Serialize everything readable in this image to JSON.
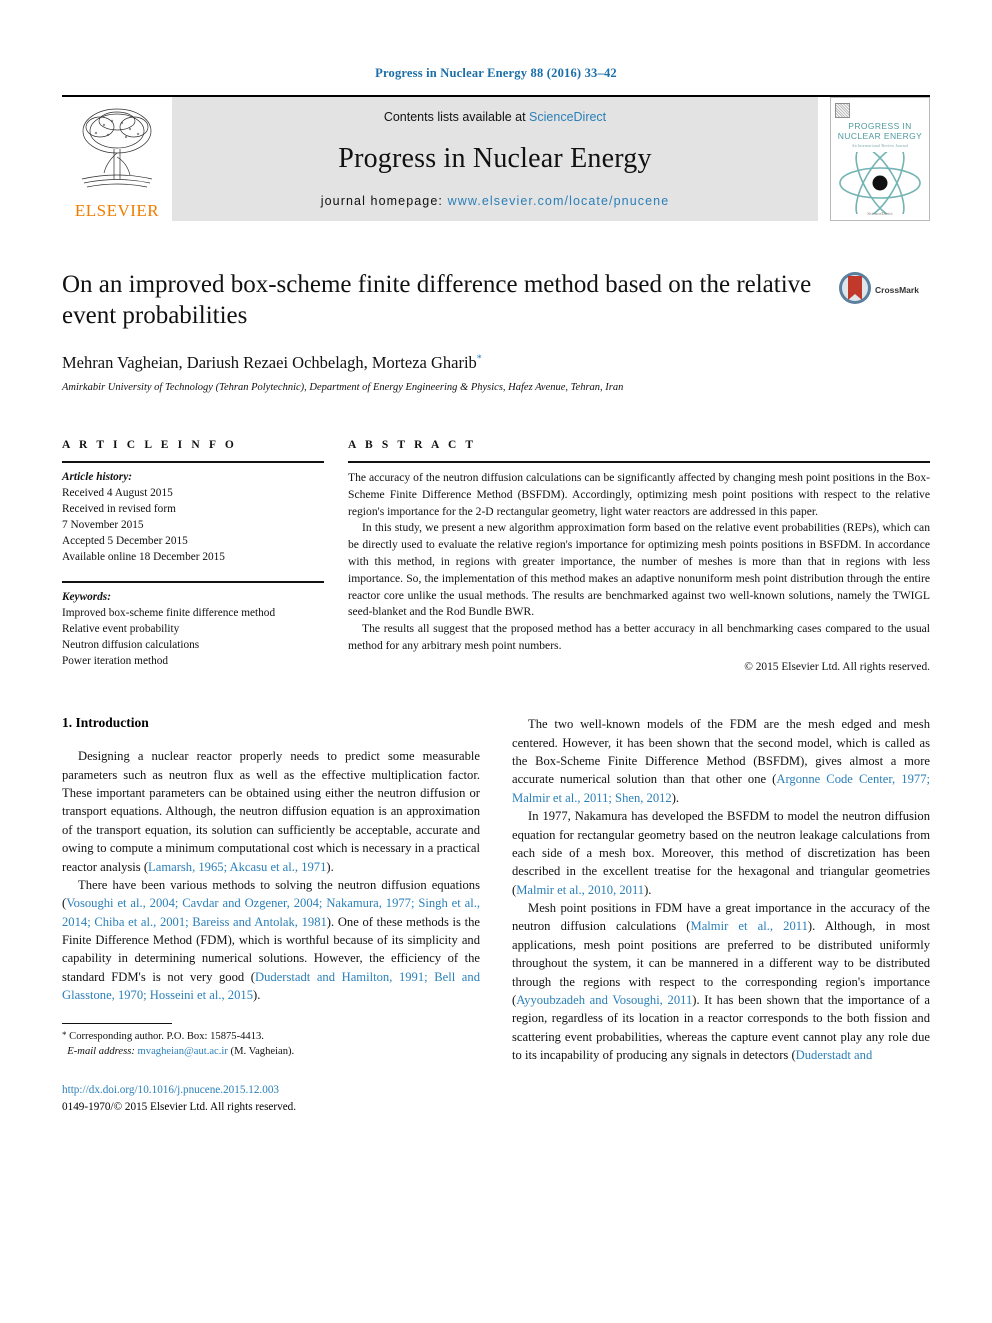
{
  "running_head": "Progress in Nuclear Energy 88 (2016) 33–42",
  "masthead": {
    "publisher_name": "ELSEVIER",
    "contents_prefix": "Contents lists available at ",
    "contents_link": "ScienceDirect",
    "journal_title": "Progress in Nuclear Energy",
    "homepage_prefix": "journal homepage: ",
    "homepage_url": "www.elsevier.com/locate/pnucene",
    "cover": {
      "title_line1": "PROGRESS IN",
      "title_line2": "NUCLEAR ENERGY",
      "subtitle": "An International Review Journal",
      "footer": "ScienceDirect"
    }
  },
  "article": {
    "title": "On an improved box-scheme finite difference method based on the relative event probabilities",
    "authors": "Mehran Vagheian, Dariush Rezaei Ochbelagh, Morteza Gharib",
    "author_marker": "*",
    "affiliation": "Amirkabir University of Technology (Tehran Polytechnic), Department of Energy Engineering & Physics, Hafez Avenue, Tehran, Iran",
    "crossmark_label": "CrossMark"
  },
  "article_info": {
    "heading": "A R T I C L E   I N F O",
    "history_label": "Article history:",
    "history": [
      "Received 4 August 2015",
      "Received in revised form",
      "7 November 2015",
      "Accepted 5 December 2015",
      "Available online 18 December 2015"
    ],
    "keywords_label": "Keywords:",
    "keywords": [
      "Improved box-scheme finite difference method",
      "Relative event probability",
      "Neutron diffusion calculations",
      "Power iteration method"
    ]
  },
  "abstract": {
    "heading": "A B S T R A C T",
    "paragraphs": [
      "The accuracy of the neutron diffusion calculations can be significantly affected by changing mesh point positions in the Box-Scheme Finite Difference Method (BSFDM). Accordingly, optimizing mesh point positions with respect to the relative region's importance for the 2-D rectangular geometry, light water reactors are addressed in this paper.",
      "In this study, we present a new algorithm approximation form based on the relative event probabilities (REPs), which can be directly used to evaluate the relative region's importance for optimizing mesh points positions in BSFDM. In accordance with this method, in regions with greater importance, the number of meshes is more than that in regions with less importance. So, the implementation of this method makes an adaptive nonuniform mesh point distribution through the entire reactor core unlike the usual methods. The results are benchmarked against two well-known solutions, namely the TWIGL seed-blanket and the Rod Bundle BWR.",
      "The results all suggest that the proposed method has a better accuracy in all benchmarking cases compared to the usual method for any arbitrary mesh point numbers."
    ],
    "copyright": "© 2015 Elsevier Ltd. All rights reserved."
  },
  "body": {
    "section_heading": "1. Introduction",
    "left_paragraphs": [
      {
        "runs": [
          {
            "t": "Designing a nuclear reactor properly needs to predict some measurable parameters such as neutron flux as well as the effective multiplication factor. These important parameters can be obtained using either the neutron diffusion or transport equations. Although, the neutron diffusion equation is an approximation of the transport equation, its solution can sufficiently be acceptable, accurate and owing to compute a minimum computational cost which is necessary in a practical reactor analysis (",
            "r": false
          },
          {
            "t": "Lamarsh, 1965; Akcasu et al., 1971",
            "r": true
          },
          {
            "t": ").",
            "r": false
          }
        ]
      },
      {
        "runs": [
          {
            "t": "There have been various methods to solving the neutron diffusion equations (",
            "r": false
          },
          {
            "t": "Vosoughi et al., 2004; Cavdar and Ozgener, 2004; Nakamura, 1977; Singh et al., 2014; Chiba et al., 2001; Bareiss and Antolak, 1981",
            "r": true
          },
          {
            "t": "). One of these methods is the Finite Difference Method (FDM), which is worthful because of its simplicity and capability in determining numerical solutions. However, the efficiency of the standard FDM's is not very good (",
            "r": false
          },
          {
            "t": "Duderstadt and Hamilton, 1991; Bell and Glasstone, 1970; Hosseini et al., 2015",
            "r": true
          },
          {
            "t": ").",
            "r": false
          }
        ]
      }
    ],
    "right_paragraphs": [
      {
        "runs": [
          {
            "t": "The two well-known models of the FDM are the mesh edged and mesh centered. However, it has been shown that the second model, which is called as the Box-Scheme Finite Difference Method (BSFDM), gives almost a more accurate numerical solution than that other one (",
            "r": false
          },
          {
            "t": "Argonne Code Center, 1977; Malmir et al., 2011; Shen, 2012",
            "r": true
          },
          {
            "t": ").",
            "r": false
          }
        ]
      },
      {
        "runs": [
          {
            "t": "In 1977, Nakamura has developed the BSFDM to model the neutron diffusion equation for rectangular geometry based on the neutron leakage calculations from each side of a mesh box. Moreover, this method of discretization has been described in the excellent treatise for the hexagonal and triangular geometries (",
            "r": false
          },
          {
            "t": "Malmir et al., 2010, 2011",
            "r": true
          },
          {
            "t": ").",
            "r": false
          }
        ]
      },
      {
        "runs": [
          {
            "t": "Mesh point positions in FDM have a great importance in the accuracy of the neutron diffusion calculations (",
            "r": false
          },
          {
            "t": "Malmir et al., 2011",
            "r": true
          },
          {
            "t": "). Although, in most applications, mesh point positions are preferred to be distributed uniformly throughout the system, it can be mannered in a different way to be distributed through the regions with respect to the corresponding region's importance (",
            "r": false
          },
          {
            "t": "Ayyoubzadeh and Vosoughi, 2011",
            "r": true
          },
          {
            "t": "). It has been shown that the importance of a region, regardless of its location in a reactor corresponds to the both fission and scattering event probabilities, whereas the capture event cannot play any role due to its incapability of producing any signals in detectors (",
            "r": false
          },
          {
            "t": "Duderstadt and",
            "r": true
          }
        ]
      }
    ]
  },
  "footer": {
    "corresponding_marker": "*",
    "corresponding_text": "Corresponding author. P.O. Box: 15875-4413.",
    "email_label": "E-mail address:",
    "email": "mvagheian@aut.ac.ir",
    "email_owner": "(M. Vagheian).",
    "doi": "http://dx.doi.org/10.1016/j.pnucene.2015.12.003",
    "issn_line": "0149-1970/© 2015 Elsevier Ltd. All rights reserved."
  },
  "colors": {
    "link": "#2b7fb8",
    "running_head": "#1a6fa8",
    "elsevier_orange": "#f07d00",
    "cover_teal": "#4e9a9e"
  }
}
